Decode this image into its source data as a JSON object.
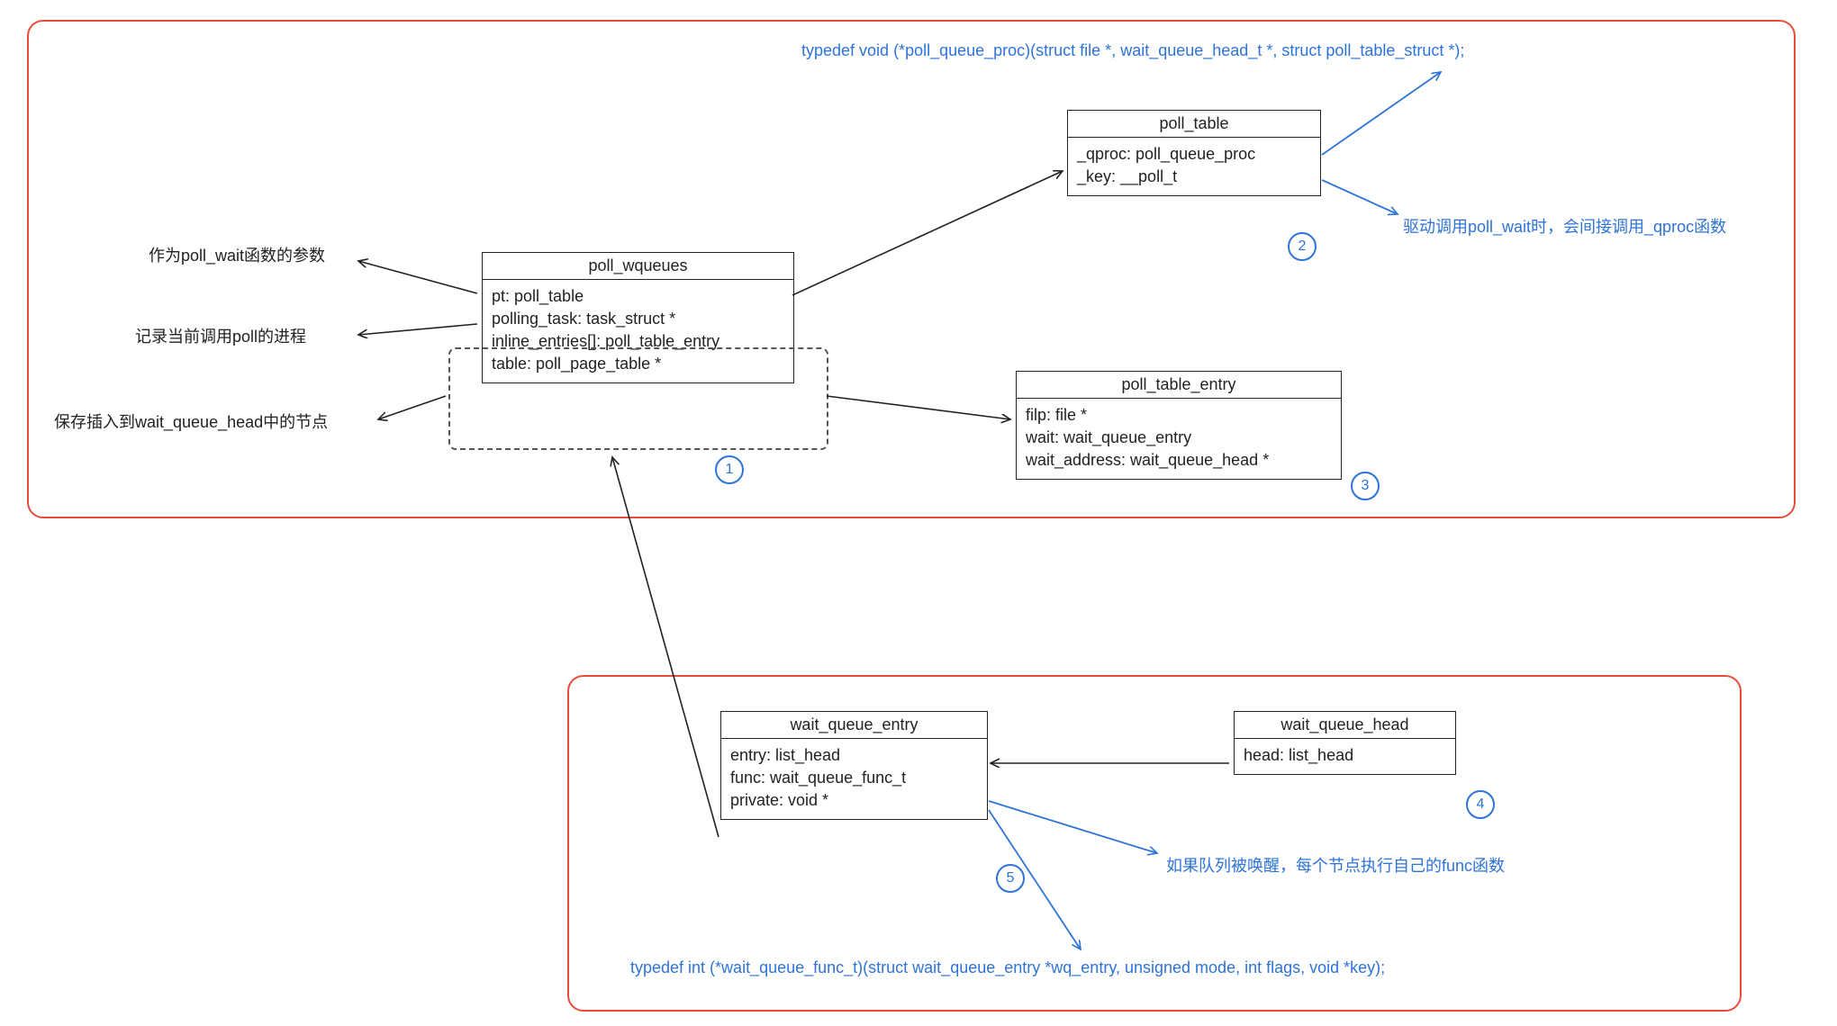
{
  "panels": {
    "top": true,
    "bottom": true
  },
  "entities": {
    "poll_wqueues": {
      "title": "poll_wqueues",
      "fields": [
        "pt: poll_table",
        "polling_task: task_struct *",
        "inline_entries[]: poll_table_entry",
        "table: poll_page_table *"
      ]
    },
    "poll_table": {
      "title": "poll_table",
      "fields": [
        "_qproc: poll_queue_proc",
        "_key: __poll_t"
      ]
    },
    "poll_table_entry": {
      "title": "poll_table_entry",
      "fields": [
        "filp: file *",
        "wait: wait_queue_entry",
        "wait_address: wait_queue_head *"
      ]
    },
    "wait_queue_entry": {
      "title": "wait_queue_entry",
      "fields": [
        "entry: list_head",
        "func: wait_queue_func_t",
        "private: void *"
      ]
    },
    "wait_queue_head": {
      "title": "wait_queue_head",
      "fields": [
        "head: list_head"
      ]
    }
  },
  "badges": {
    "b1": "1",
    "b2": "2",
    "b3": "3",
    "b4": "4",
    "b5": "5"
  },
  "notes": {
    "typedef_proc": "typedef void (*poll_queue_proc)(struct file *, wait_queue_head_t *, struct poll_table_struct *);",
    "qproc_call": "驱动调用poll_wait时，会间接调用_qproc函数",
    "arg_pollwait": "作为poll_wait函数的参数",
    "record_proc": "记录当前调用poll的进程",
    "save_node": "保存插入到wait_queue_head中的节点",
    "func_exec": "如果队列被唤醒，每个节点执行自己的func函数",
    "typedef_wqfunc": "typedef int (*wait_queue_func_t)(struct wait_queue_entry *wq_entry, unsigned mode, int flags, void *key);"
  }
}
